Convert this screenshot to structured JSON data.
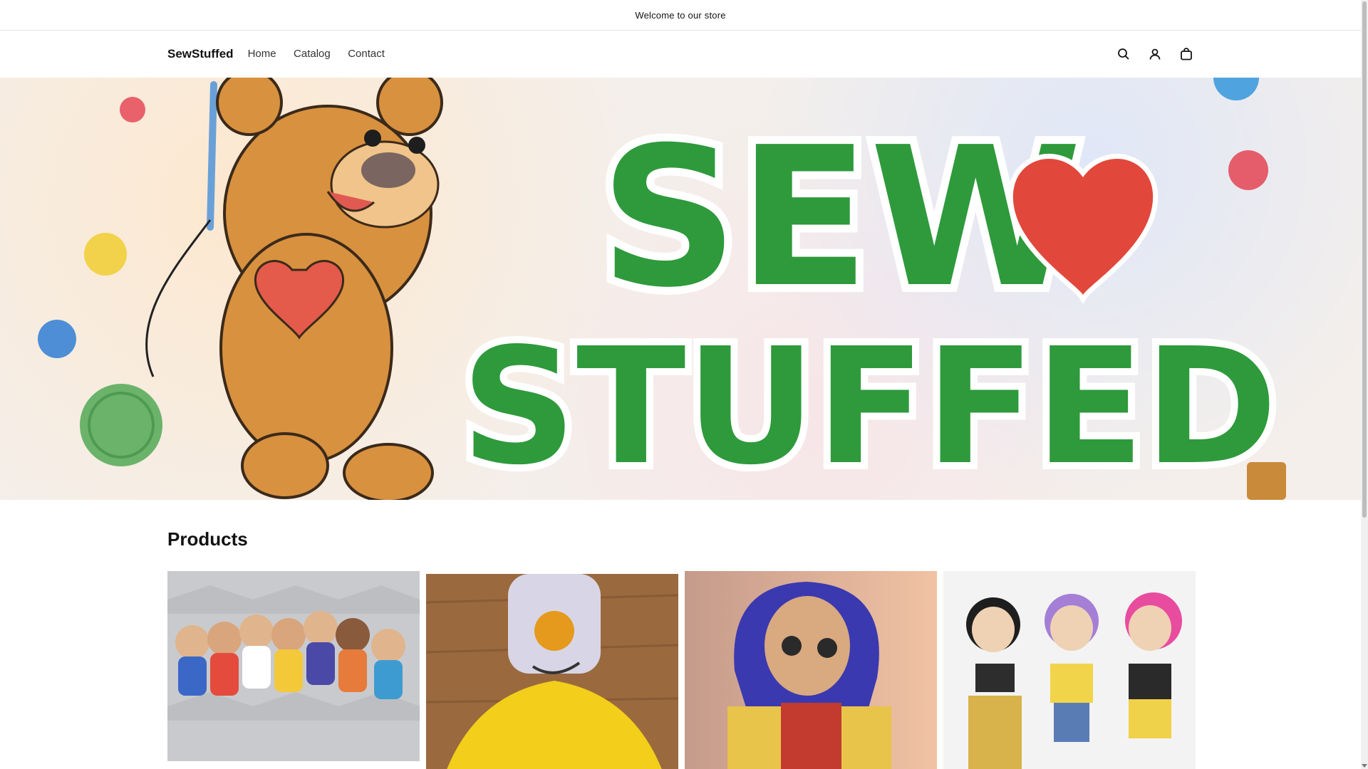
{
  "announcement": {
    "text": "Welcome to our store"
  },
  "header": {
    "logo": "SewStuffed",
    "nav": [
      {
        "label": "Home"
      },
      {
        "label": "Catalog"
      },
      {
        "label": "Contact"
      }
    ],
    "icons": [
      "search-icon",
      "account-icon",
      "cart-icon"
    ]
  },
  "hero": {
    "banner_line1": "SEW",
    "banner_line2": "STUFFED",
    "colors": {
      "text_green": "#2e9a3c",
      "heart_red": "#e2473c",
      "bear_brown": "#d8913f"
    }
  },
  "products": {
    "title": "Products",
    "items": [
      {
        "image": "crochet-dolls-group"
      },
      {
        "image": "yellow-duck-lovey"
      },
      {
        "image": "blue-haired-doll"
      },
      {
        "image": "three-fashion-dolls"
      }
    ]
  }
}
